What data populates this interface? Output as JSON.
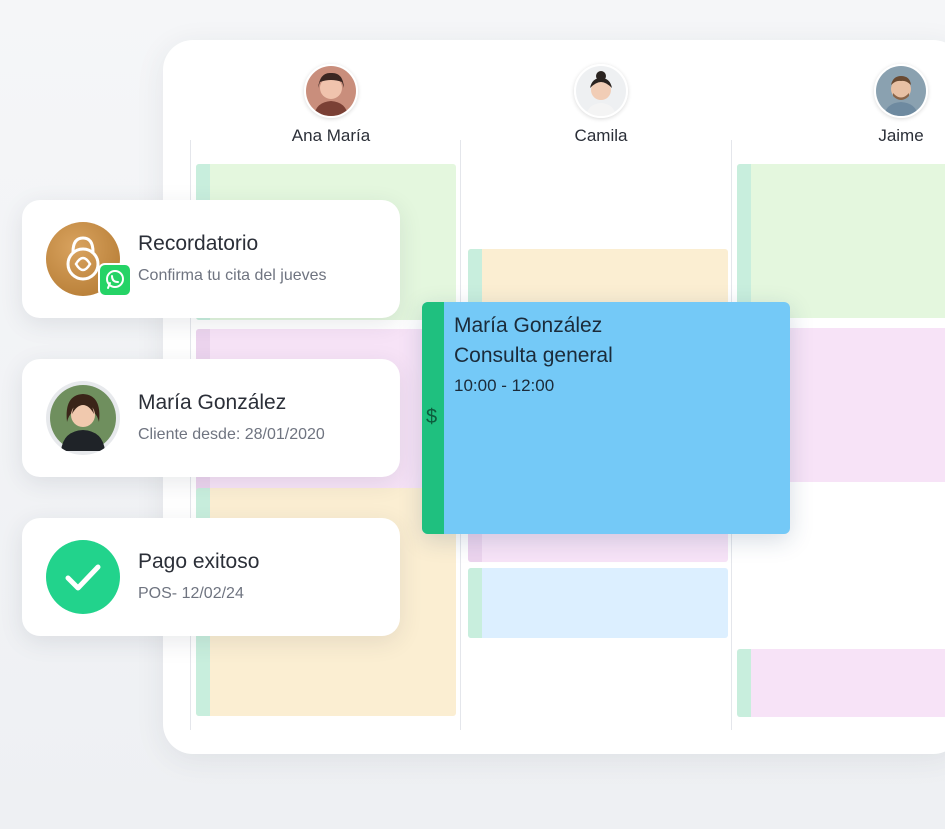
{
  "staff": [
    {
      "name": "Ana María"
    },
    {
      "name": "Camila"
    },
    {
      "name": "Jaime"
    }
  ],
  "notifications": {
    "reminder": {
      "title": "Recordatorio",
      "subtitle": "Confirma tu cita del jueves"
    },
    "client": {
      "title": "María González",
      "subtitle": "Cliente desde: 28/01/2020"
    },
    "payment": {
      "title": "Pago exitoso",
      "subtitle": "POS- 12/02/24"
    }
  },
  "appointment": {
    "client": "María González",
    "service": "Consulta general",
    "time": "10:00 - 12:00",
    "payment_symbol": "$"
  },
  "colors": {
    "green_event": "#e4f7de",
    "yellow_event": "#fbeed2",
    "pink_event": "#f7e3f7",
    "blue_event": "#dcefff",
    "accent_green": "#1fc07f",
    "popup_blue": "#74c9f7"
  }
}
